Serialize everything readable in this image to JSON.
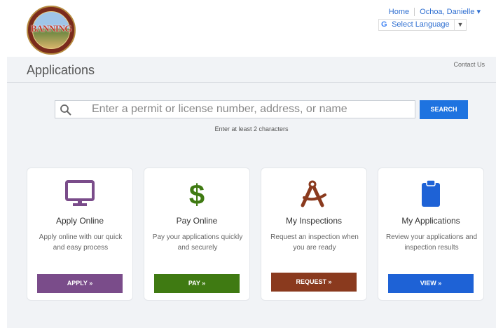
{
  "header": {
    "logo_text": "BANNING",
    "nav": {
      "home": "Home",
      "user": "Ochoa, Danielle ▾"
    },
    "language": {
      "label": "Select Language",
      "arrow": "▼"
    }
  },
  "main": {
    "title": "Applications",
    "contact": "Contact Us",
    "search": {
      "placeholder": "Enter a permit or license number, address, or name",
      "button": "SEARCH",
      "hint": "Enter at least 2 characters"
    },
    "cards": [
      {
        "title": "Apply Online",
        "desc": "Apply online with our quick and easy process",
        "button": "APPLY »",
        "icon": "monitor-icon",
        "color": "#7a4c8a"
      },
      {
        "title": "Pay Online",
        "desc": "Pay your applications quickly and securely",
        "button": "PAY »",
        "icon": "dollar-icon",
        "color": "#3f7a12"
      },
      {
        "title": "My Inspections",
        "desc": "Request an inspection when you are ready",
        "button": "REQUEST »",
        "icon": "compass-icon",
        "color": "#8a3a1e"
      },
      {
        "title": "My Applications",
        "desc": "Review your applications and inspection results",
        "button": "VIEW »",
        "icon": "clipboard-icon",
        "color": "#1e62d6"
      }
    ]
  }
}
